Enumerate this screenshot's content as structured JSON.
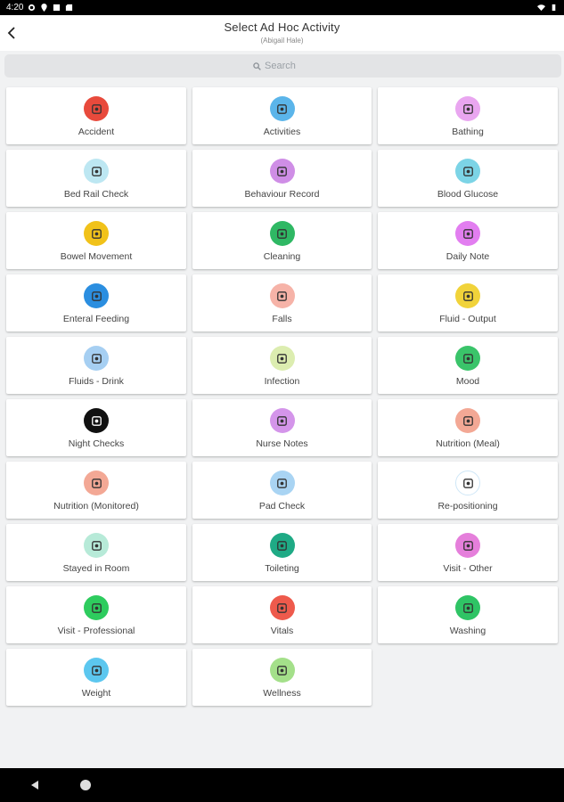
{
  "status_bar": {
    "time": "4:20"
  },
  "header": {
    "title": "Select Ad Hoc Activity",
    "subtitle": "(Abigail Hale)"
  },
  "search": {
    "placeholder": "Search"
  },
  "activities": [
    {
      "label": "Accident",
      "icon": "accident-icon",
      "color": "#e84a3c"
    },
    {
      "label": "Activities",
      "icon": "activities-icon",
      "color": "#5bb5ea"
    },
    {
      "label": "Bathing",
      "icon": "bathing-icon",
      "color": "#e9a6f0"
    },
    {
      "label": "Bed Rail Check",
      "icon": "bed-rail-icon",
      "color": "#bde7f2"
    },
    {
      "label": "Behaviour Record",
      "icon": "behaviour-record-icon",
      "color": "#cf8ee6"
    },
    {
      "label": "Blood Glucose",
      "icon": "blood-glucose-icon",
      "color": "#7cd4e6"
    },
    {
      "label": "Bowel Movement",
      "icon": "bowel-movement-icon",
      "color": "#f1c21a"
    },
    {
      "label": "Cleaning",
      "icon": "cleaning-icon",
      "color": "#2fb864"
    },
    {
      "label": "Daily Note",
      "icon": "daily-note-icon",
      "color": "#e27ef0"
    },
    {
      "label": "Enteral Feeding",
      "icon": "enteral-feeding-icon",
      "color": "#2b8ee0"
    },
    {
      "label": "Falls",
      "icon": "falls-icon",
      "color": "#f6b3a8"
    },
    {
      "label": "Fluid - Output",
      "icon": "fluid-output-icon",
      "color": "#f1d33a"
    },
    {
      "label": "Fluids - Drink",
      "icon": "fluids-drink-icon",
      "color": "#a6cff2"
    },
    {
      "label": "Infection",
      "icon": "infection-icon",
      "color": "#dcedb0"
    },
    {
      "label": "Mood",
      "icon": "mood-icon",
      "color": "#3ac46a"
    },
    {
      "label": "Night Checks",
      "icon": "night-checks-icon",
      "color": "#111111"
    },
    {
      "label": "Nurse Notes",
      "icon": "nurse-notes-icon",
      "color": "#d495ea"
    },
    {
      "label": "Nutrition (Meal)",
      "icon": "nutrition-meal-icon",
      "color": "#f3a895"
    },
    {
      "label": "Nutrition (Monitored)",
      "icon": "nutrition-monitored-icon",
      "color": "#f3a895"
    },
    {
      "label": "Pad Check",
      "icon": "pad-check-icon",
      "color": "#a9d4f3"
    },
    {
      "label": "Re-positioning",
      "icon": "repositioning-icon",
      "color": "#ffffff"
    },
    {
      "label": "Stayed in Room",
      "icon": "stayed-in-room-icon",
      "color": "#b7ead8"
    },
    {
      "label": "Toileting",
      "icon": "toileting-icon",
      "color": "#1faa85"
    },
    {
      "label": "Visit - Other",
      "icon": "visit-other-icon",
      "color": "#e57fdb"
    },
    {
      "label": "Visit - Professional",
      "icon": "visit-professional-icon",
      "color": "#2ecc5e"
    },
    {
      "label": "Vitals",
      "icon": "vitals-icon",
      "color": "#ee5a4c"
    },
    {
      "label": "Washing",
      "icon": "washing-icon",
      "color": "#2fc465"
    },
    {
      "label": "Weight",
      "icon": "weight-icon",
      "color": "#5cc7ef"
    },
    {
      "label": "Wellness",
      "icon": "wellness-icon",
      "color": "#a4e08a"
    }
  ]
}
